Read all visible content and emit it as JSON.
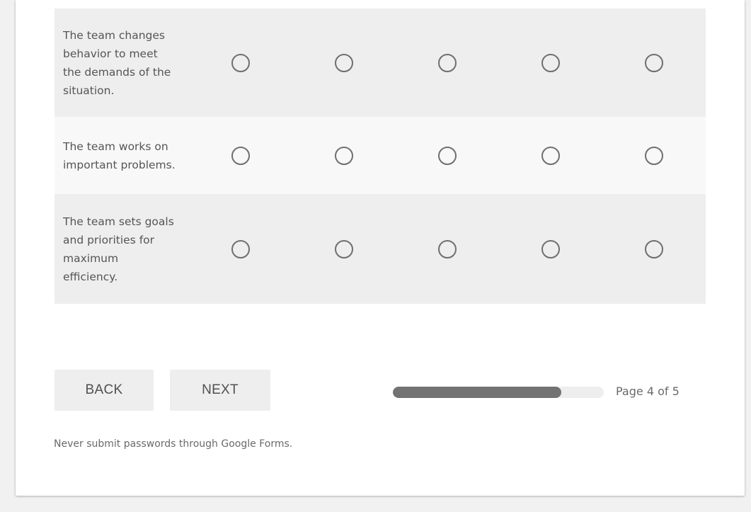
{
  "grid": {
    "rows": [
      {
        "label": "The team changes behavior to meet the demands of the situation."
      },
      {
        "label": "The team works on important problems."
      },
      {
        "label": "The team sets goals and priorities for maximum efficiency."
      }
    ],
    "options_per_row": 5
  },
  "navigation": {
    "back_label": "BACK",
    "next_label": "NEXT"
  },
  "progress": {
    "fraction": 0.8,
    "page_text": "Page 4 of 5"
  },
  "footer": {
    "disclaimer": "Never submit passwords through Google Forms."
  },
  "colors": {
    "radio_border": "#6f6f6f",
    "progress_fill": "#737373",
    "row_shaded": "#eeeeee",
    "button_bg": "#eeeeee"
  }
}
